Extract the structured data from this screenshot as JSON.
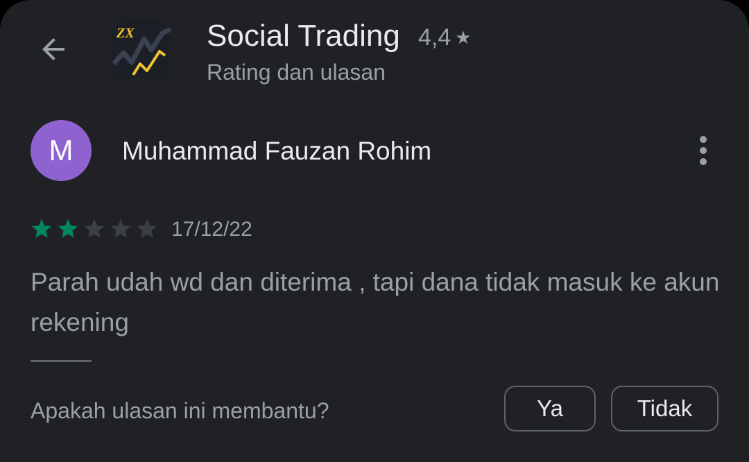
{
  "header": {
    "app_title": "Social Trading",
    "app_rating": "4,4",
    "subtitle": "Rating dan ulasan",
    "app_icon_text": "ZX"
  },
  "review": {
    "avatar_letter": "M",
    "reviewer_name": "Muhammad Fauzan Rohim",
    "rating": 2,
    "max_rating": 5,
    "date": "17/12/22",
    "text": "Parah udah wd dan diterima , tapi dana tidak masuk ke akun rekening"
  },
  "helpful": {
    "question": "Apakah ulasan ini membantu?",
    "yes_label": "Ya",
    "no_label": "Tidak"
  },
  "colors": {
    "background": "#202124",
    "star_filled": "#01875f",
    "star_empty": "#3c4043",
    "avatar": "#8e63d0",
    "icon_accent": "#f2c230"
  }
}
